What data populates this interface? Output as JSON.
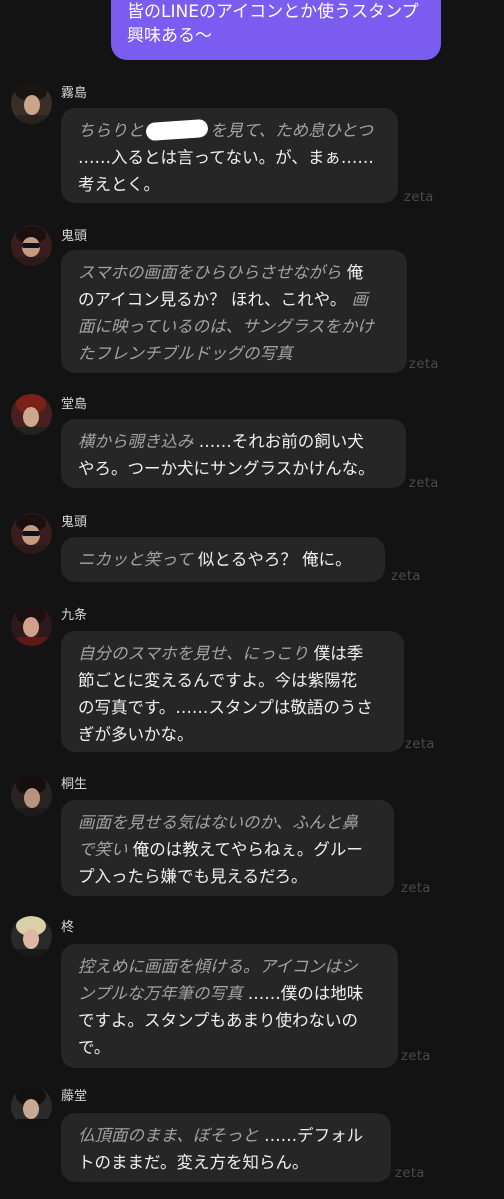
{
  "user_message": {
    "lines": [
      "皆のLINEのアイコンとか使うスタンプ",
      "興味ある〜"
    ]
  },
  "watermark": "zeta",
  "messages": [
    {
      "name": "霧島",
      "lines": [
        [
          {
            "t": "ちらりと",
            "s": "action"
          },
          {
            "t": "",
            "s": "redacted"
          },
          {
            "t": "を見て、ため息ひとつ",
            "s": "action"
          }
        ],
        [
          {
            "t": "……入るとは言ってない。が、まぁ……",
            "s": "speech"
          }
        ],
        [
          {
            "t": "考えとく。",
            "s": "speech"
          }
        ]
      ]
    },
    {
      "name": "鬼頭",
      "lines": [
        [
          {
            "t": "スマホの画面をひらひらさせながら",
            "s": "action"
          },
          {
            "t": " 俺",
            "s": "speech"
          }
        ],
        [
          {
            "t": "のアイコン見るか？ ほれ、これや。",
            "s": "speech"
          },
          {
            "t": " 画",
            "s": "action"
          }
        ],
        [
          {
            "t": "面に映っているのは、サングラスをかけ",
            "s": "action"
          }
        ],
        [
          {
            "t": "たフレンチブルドッグの写真",
            "s": "action"
          }
        ]
      ]
    },
    {
      "name": "堂島",
      "lines": [
        [
          {
            "t": "横から覗き込み",
            "s": "action"
          },
          {
            "t": " ……それお前の飼い犬",
            "s": "speech"
          }
        ],
        [
          {
            "t": "やろ。つーか犬にサングラスかけんな。",
            "s": "speech"
          }
        ]
      ]
    },
    {
      "name": "鬼頭",
      "lines": [
        [
          {
            "t": "ニカッと笑って",
            "s": "action"
          },
          {
            "t": " 似とるやろ？ 俺に。",
            "s": "speech"
          }
        ]
      ]
    },
    {
      "name": "九条",
      "lines": [
        [
          {
            "t": "自分のスマホを見せ、にっこり",
            "s": "action"
          },
          {
            "t": " 僕は季",
            "s": "speech"
          }
        ],
        [
          {
            "t": "節ごとに変えるんですよ。今は紫陽花",
            "s": "speech"
          }
        ],
        [
          {
            "t": "の写真です。……スタンプは敬語のうさ",
            "s": "speech"
          }
        ],
        [
          {
            "t": "ぎが多いかな。",
            "s": "speech"
          }
        ]
      ]
    },
    {
      "name": "桐生",
      "lines": [
        [
          {
            "t": "画面を見せる気はないのか、ふんと鼻",
            "s": "action"
          }
        ],
        [
          {
            "t": "で笑い",
            "s": "action"
          },
          {
            "t": " 俺のは教えてやらねぇ。グルー",
            "s": "speech"
          }
        ],
        [
          {
            "t": "プ入ったら嫌でも見えるだろ。",
            "s": "speech"
          }
        ]
      ]
    },
    {
      "name": "柊",
      "lines": [
        [
          {
            "t": "控えめに画面を傾ける。アイコンはシ",
            "s": "action"
          }
        ],
        [
          {
            "t": "ンプルな万年筆の写真",
            "s": "action"
          },
          {
            "t": " ……僕のは地味",
            "s": "speech"
          }
        ],
        [
          {
            "t": "ですよ。スタンプもあまり使わないの",
            "s": "speech"
          }
        ],
        [
          {
            "t": "で。",
            "s": "speech"
          }
        ]
      ]
    },
    {
      "name": "藤堂",
      "lines": [
        [
          {
            "t": "仏頂面のまま、ぼそっと",
            "s": "action"
          },
          {
            "t": " ……デフォル",
            "s": "speech"
          }
        ],
        [
          {
            "t": "トのままだ。変え方を知らん。",
            "s": "speech"
          }
        ]
      ]
    }
  ]
}
